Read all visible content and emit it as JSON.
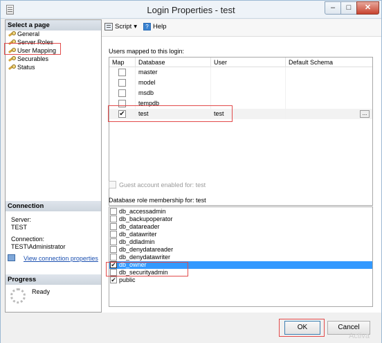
{
  "window": {
    "title": "Login Properties - test"
  },
  "titlebar": {
    "minimize": "–",
    "maximize": "□",
    "close": "✕"
  },
  "left_pane": {
    "select_page_header": "Select a page",
    "pages": [
      {
        "label": "General"
      },
      {
        "label": "Server Roles"
      },
      {
        "label": "User Mapping"
      },
      {
        "label": "Securables"
      },
      {
        "label": "Status"
      }
    ],
    "connection_header": "Connection",
    "server_label": "Server:",
    "server_value": "TEST",
    "connection_label": "Connection:",
    "connection_value": "TEST\\Administrator",
    "view_link": "View connection properties",
    "progress_header": "Progress",
    "progress_status": "Ready"
  },
  "toolbar": {
    "script_label": "Script",
    "help_label": "Help"
  },
  "users_mapped": {
    "label": "Users mapped to this login:",
    "columns": [
      "Map",
      "Database",
      "User",
      "Default Schema"
    ],
    "rows": [
      {
        "map": false,
        "database": "master",
        "user": "",
        "schema": ""
      },
      {
        "map": false,
        "database": "model",
        "user": "",
        "schema": ""
      },
      {
        "map": false,
        "database": "msdb",
        "user": "",
        "schema": ""
      },
      {
        "map": false,
        "database": "tempdb",
        "user": "",
        "schema": ""
      },
      {
        "map": true,
        "database": "test",
        "user": "test",
        "schema": ""
      }
    ],
    "ellipsis": "..."
  },
  "guest": {
    "label": "Guest account enabled for: test",
    "checked": false
  },
  "roles": {
    "label": "Database role membership for: test",
    "items": [
      {
        "name": "db_accessadmin",
        "checked": false
      },
      {
        "name": "db_backupoperator",
        "checked": false
      },
      {
        "name": "db_datareader",
        "checked": false
      },
      {
        "name": "db_datawriter",
        "checked": false
      },
      {
        "name": "db_ddladmin",
        "checked": false
      },
      {
        "name": "db_denydatareader",
        "checked": false
      },
      {
        "name": "db_denydatawriter",
        "checked": false
      },
      {
        "name": "db_owner",
        "checked": true
      },
      {
        "name": "db_securityadmin",
        "checked": false
      },
      {
        "name": "public",
        "checked": true
      }
    ]
  },
  "buttons": {
    "ok": "OK",
    "cancel": "Cancel"
  },
  "watermark": "Activa"
}
